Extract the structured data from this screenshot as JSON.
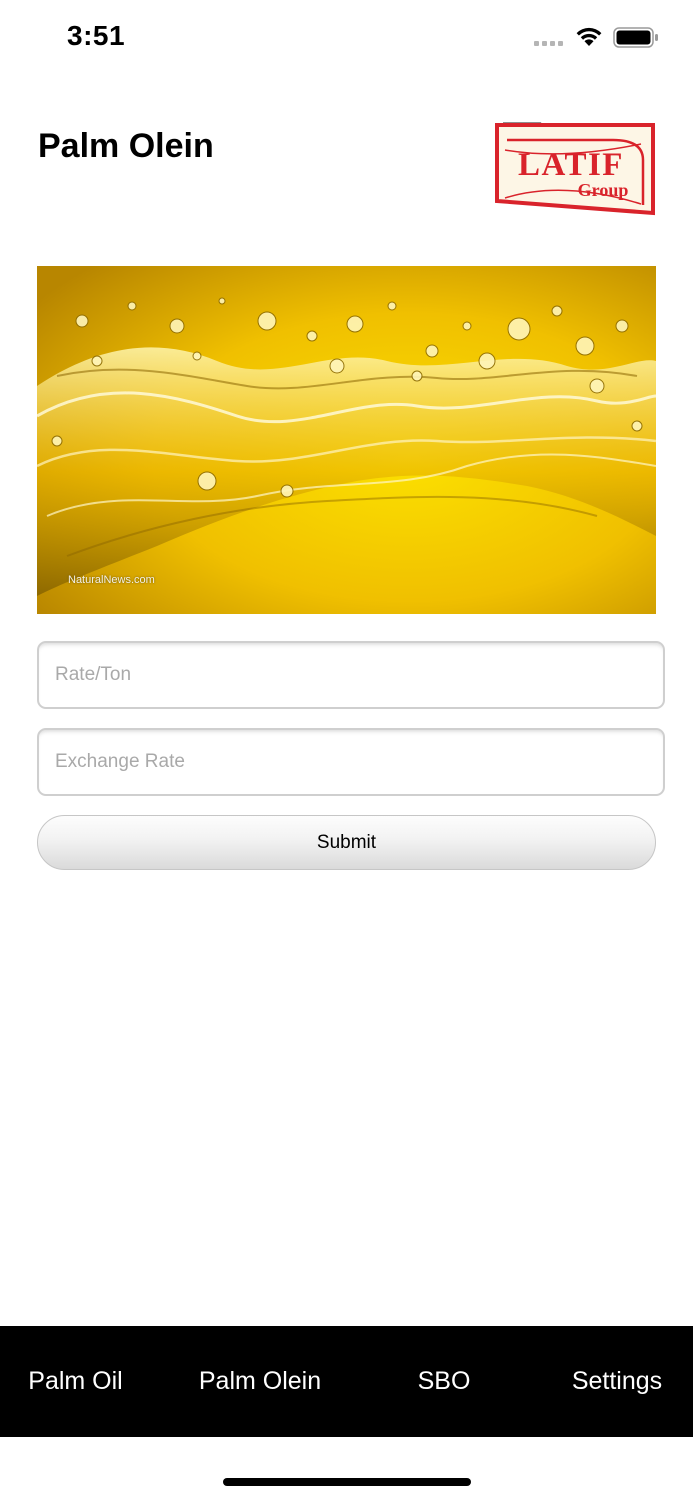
{
  "status_bar": {
    "time": "3:51",
    "icons": [
      "cellular-signal-icon",
      "wifi-icon",
      "battery-icon"
    ]
  },
  "header": {
    "title": "Palm Olein",
    "logo": {
      "line1": "LATIF",
      "line2": "Group",
      "colors": {
        "red": "#d9232b",
        "cream": "#fdf6e6"
      }
    }
  },
  "hero": {
    "caption": "NaturalNews.com",
    "colors": {
      "gold": "#f2c300",
      "deep_gold": "#c89500"
    }
  },
  "form": {
    "rate_field": {
      "placeholder": "Rate/Ton",
      "value": ""
    },
    "exchange_field": {
      "placeholder": "Exchange Rate",
      "value": ""
    },
    "submit_label": "Submit"
  },
  "tab_bar": {
    "background": "#000000",
    "items": [
      {
        "label": "Palm Oil"
      },
      {
        "label": "Palm Olein"
      },
      {
        "label": "SBO"
      },
      {
        "label": "Settings"
      }
    ]
  }
}
